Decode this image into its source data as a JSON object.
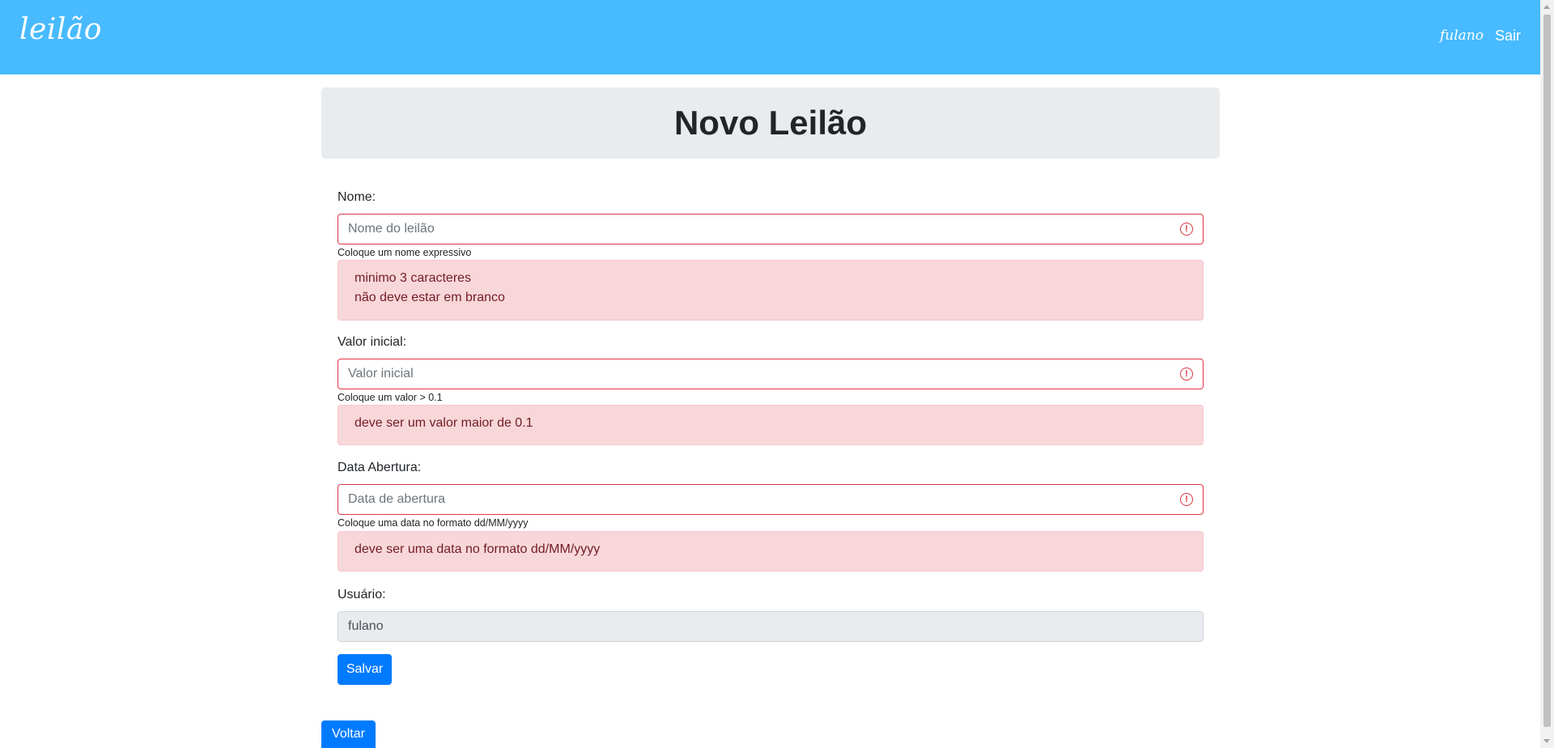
{
  "navbar": {
    "brand": "leilão",
    "user": "fulano",
    "logout": "Sair"
  },
  "page": {
    "title": "Novo Leilão"
  },
  "form": {
    "nome": {
      "label": "Nome:",
      "placeholder": "Nome do leilão",
      "help": "Coloque um nome expressivo",
      "errors": [
        "minimo 3 caracteres",
        "não deve estar em branco"
      ]
    },
    "valor": {
      "label": "Valor inicial:",
      "placeholder": "Valor inicial",
      "help": "Coloque um valor > 0.1",
      "errors": [
        "deve ser um valor maior de 0.1"
      ]
    },
    "data": {
      "label": "Data Abertura:",
      "placeholder": "Data de abertura",
      "help": "Coloque uma data no formato dd/MM/yyyy",
      "errors": [
        "deve ser uma data no formato dd/MM/yyyy"
      ]
    },
    "usuario": {
      "label": "Usuário:",
      "value": "fulano"
    },
    "save_label": "Salvar"
  },
  "back_label": "Voltar",
  "icons": {
    "error": "exclamation-circle-icon"
  },
  "colors": {
    "navbar": "#48baff",
    "primary": "#007bff",
    "danger": "#dc3545",
    "alert_bg": "#f8d7da",
    "alert_text": "#721c24",
    "jumbotron": "#e9ecef"
  }
}
